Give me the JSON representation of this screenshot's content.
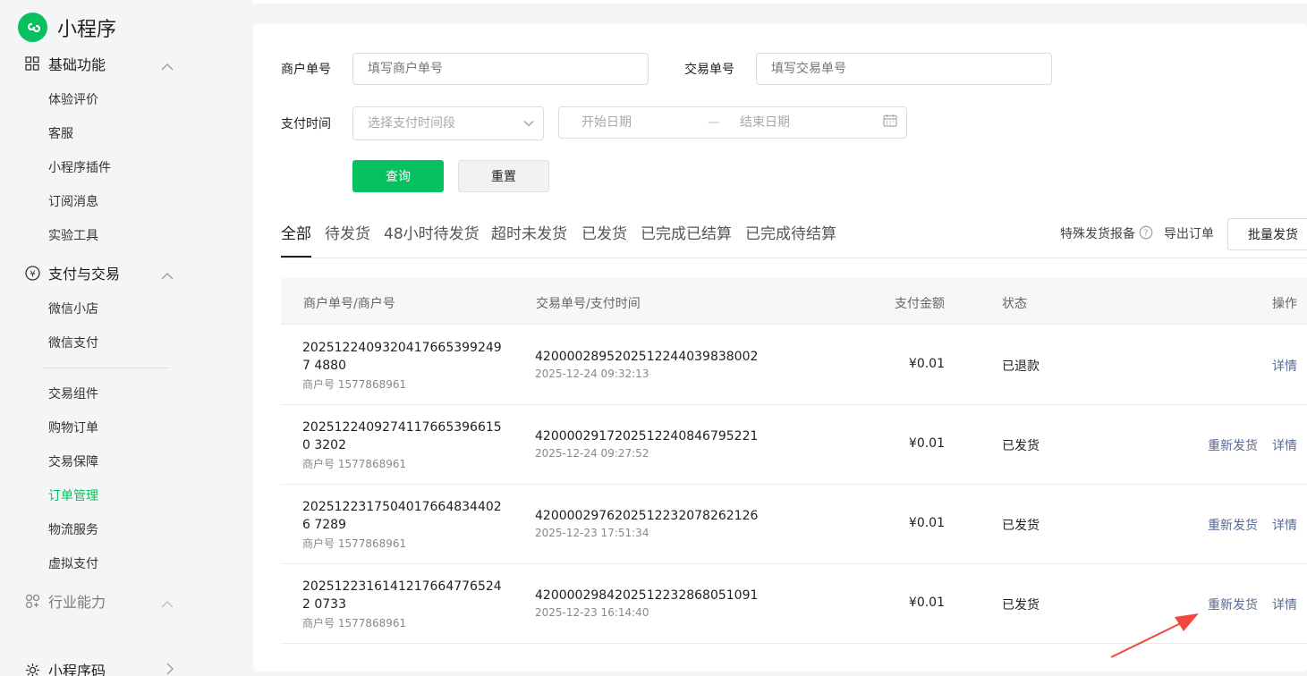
{
  "sidebar": {
    "brand": "小程序",
    "sections": [
      {
        "label": "基础功能",
        "icon": "grid-icon",
        "items": [
          "体验评价",
          "客服",
          "小程序插件",
          "订阅消息",
          "实验工具"
        ]
      },
      {
        "label": "支付与交易",
        "icon": "yen-icon",
        "items": [
          "微信小店",
          "微信支付"
        ],
        "items_after_divider": [
          "交易组件",
          "购物订单",
          "交易保障",
          "订单管理",
          "物流服务",
          "虚拟支付"
        ],
        "active_item": "订单管理"
      },
      {
        "label": "行业能力",
        "icon": "industry-icon"
      },
      {
        "label": "小程序码",
        "icon": "code-icon"
      }
    ]
  },
  "filters": {
    "merchant_order_label": "商户单号",
    "merchant_order_placeholder": "填写商户单号",
    "trade_no_label": "交易单号",
    "trade_no_placeholder": "填写交易单号",
    "pay_time_label": "支付时间",
    "pay_time_select_placeholder": "选择支付时间段",
    "start_date_placeholder": "开始日期",
    "range_separator": "—",
    "end_date_placeholder": "结束日期",
    "query_button": "查询",
    "reset_button": "重置"
  },
  "tabs": [
    "全部",
    "待发货",
    "48小时待发货",
    "超时未发货",
    "已发货",
    "已完成已结算",
    "已完成待结算"
  ],
  "active_tab": "全部",
  "actions": {
    "special_report": "特殊发货报备",
    "export_orders": "导出订单",
    "batch_ship": "批量发货"
  },
  "table": {
    "headers": [
      "商户单号/商户号",
      "交易单号/支付时间",
      "支付金额",
      "状态",
      "操作"
    ],
    "rows": [
      {
        "merchant_order": "20251224093204176653992497 4880",
        "merchant_no": "商户号 1577868961",
        "trade_no": "4200002895202512244039838002",
        "pay_time": "2025-12-24 09:32:13",
        "amount": "¥0.01",
        "status": "已退款",
        "reship": "",
        "detail": "详情"
      },
      {
        "merchant_order": "20251224092741176653966150 3202",
        "merchant_no": "商户号 1577868961",
        "trade_no": "4200002917202512240846795221",
        "pay_time": "2025-12-24 09:27:52",
        "amount": "¥0.01",
        "status": "已发货",
        "reship": "重新发货",
        "detail": "详情"
      },
      {
        "merchant_order": "20251223175040176648344026 7289",
        "merchant_no": "商户号 1577868961",
        "trade_no": "4200002976202512232078262126",
        "pay_time": "2025-12-23 17:51:34",
        "amount": "¥0.01",
        "status": "已发货",
        "reship": "重新发货",
        "detail": "详情"
      },
      {
        "merchant_order": "20251223161412176647765242 0733",
        "merchant_no": "商户号 1577868961",
        "trade_no": "4200002984202512232868051091",
        "pay_time": "2025-12-23 16:14:40",
        "amount": "¥0.01",
        "status": "已发货",
        "reship": "重新发货",
        "detail": "详情"
      }
    ]
  },
  "colors": {
    "brand_green": "#07c160",
    "link_blue": "#576b95",
    "annotation_arrow": "#f0483e"
  }
}
